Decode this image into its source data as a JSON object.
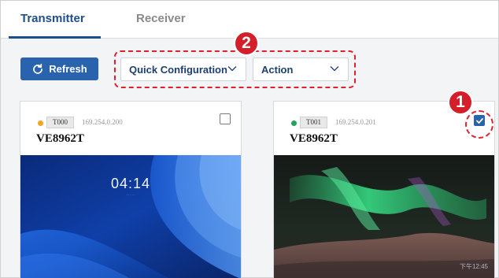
{
  "tabs": [
    {
      "label": "Transmitter",
      "active": true
    },
    {
      "label": "Receiver",
      "active": false
    }
  ],
  "toolbar": {
    "refresh_label": "Refresh",
    "quick_config_label": "Quick Configuration",
    "action_label": "Action"
  },
  "annotations": {
    "callout_1": "1",
    "callout_2": "2"
  },
  "devices": [
    {
      "id": "T000",
      "ip": "169.254.0.200",
      "model": "VE8962T",
      "status_color": "#f2a51d",
      "selected": false,
      "preview": {
        "clock": "04:14",
        "date": "· · · · ·"
      }
    },
    {
      "id": "T001",
      "ip": "169.254.0.201",
      "model": "VE8962T",
      "status_color": "#23a35a",
      "selected": true,
      "preview": {
        "corner_time": "下午12:45"
      }
    }
  ],
  "colors": {
    "accent": "#1e4f8a",
    "button": "#2a63ad",
    "callout": "#d41f2b"
  }
}
